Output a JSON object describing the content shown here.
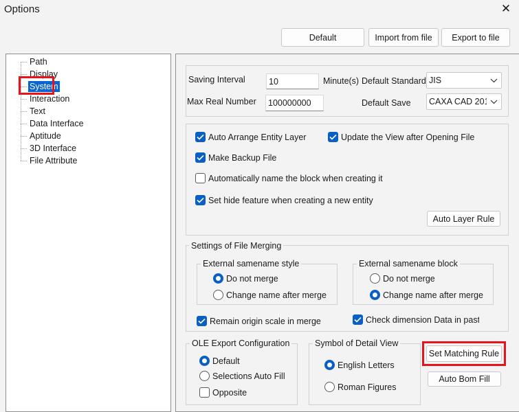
{
  "window": {
    "title": "Options",
    "close_glyph": "✕"
  },
  "top_buttons": {
    "default": "Default",
    "import": "Import from file",
    "export": "Export to file"
  },
  "tree": {
    "items": [
      {
        "label": "Path"
      },
      {
        "label": "Display"
      },
      {
        "label": "System",
        "selected": true
      },
      {
        "label": "Interaction"
      },
      {
        "label": "Text"
      },
      {
        "label": "Data Interface"
      },
      {
        "label": "Aptitude"
      },
      {
        "label": "3D Interface"
      },
      {
        "label": "File Attribute"
      }
    ]
  },
  "settings": {
    "saving_interval_label": "Saving Interval",
    "saving_interval_value": "10",
    "minutes_label": "Minute(s)",
    "default_standard_label": "Default Standard",
    "default_standard_value": "JIS",
    "max_real_label": "Max Real Number",
    "max_real_value": "100000000",
    "default_save_label": "Default Save",
    "default_save_value": "CAXA CAD 201"
  },
  "options": {
    "auto_arrange": {
      "label": "Auto Arrange Entity Layer",
      "checked": true
    },
    "update_view": {
      "label": "Update the View after Opening File",
      "checked": true
    },
    "make_backup": {
      "label": "Make Backup File",
      "checked": true
    },
    "auto_name_block": {
      "label": "Automatically name the block when creating it",
      "checked": false
    },
    "hide_feature": {
      "label": "Set hide feature when creating a new entity",
      "checked": true
    },
    "auto_layer_rule": "Auto Layer Rule"
  },
  "merging": {
    "title": "Settings of File Merging",
    "style_group": "External samename style",
    "style_no_merge": "Do not merge",
    "style_change_name": "Change name after merge",
    "block_group": "External samename block",
    "block_no_merge": "Do not merge",
    "block_change_name": "Change name after merge",
    "remain_scale": {
      "label": "Remain origin scale in merge",
      "checked": true
    },
    "check_dimension": {
      "label": "Check dimension Data in paste",
      "checked": true
    }
  },
  "ole": {
    "title": "OLE Export Configuration",
    "default": "Default",
    "selections_auto_fill": "Selections Auto Fill",
    "opposite": {
      "label": "Opposite",
      "checked": false
    }
  },
  "detail_view": {
    "title": "Symbol of Detail View",
    "english": "English Letters",
    "roman": "Roman Figures"
  },
  "side_buttons": {
    "set_matching_rule": "Set Matching Rule",
    "auto_bom_fill": "Auto Bom Fill"
  },
  "colors": {
    "accent": "#0a5fc4",
    "highlight_box": "#e8141b",
    "selection": "#0a64d2"
  }
}
